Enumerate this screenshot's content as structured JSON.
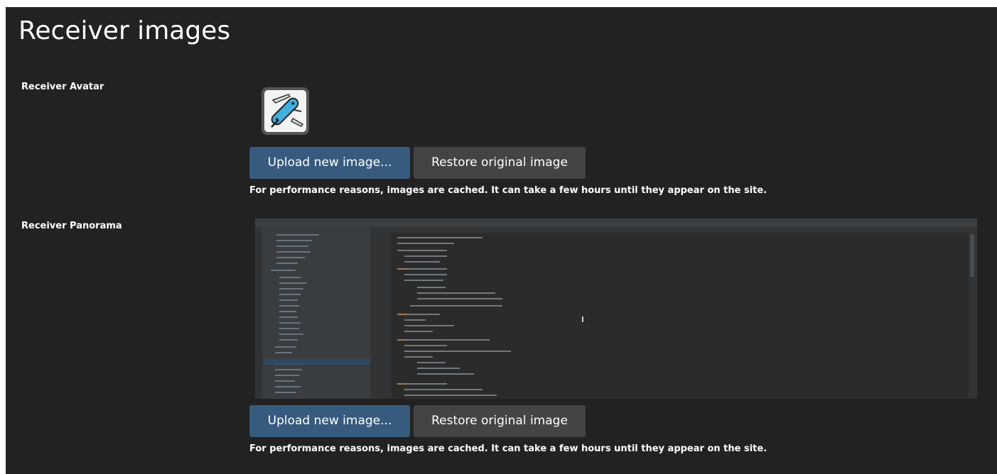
{
  "page": {
    "title": "Receiver images"
  },
  "avatar_section": {
    "label": "Receiver Avatar",
    "upload_label": "Upload new image...",
    "restore_label": "Restore original image",
    "help_text": "For performance reasons, images are cached. It can take a few hours until they appear on the site."
  },
  "panorama_section": {
    "label": "Receiver Panorama",
    "upload_label": "Upload new image...",
    "restore_label": "Restore original image",
    "help_text": "For performance reasons, images are cached. It can take a few hours until they appear on the site."
  },
  "colors": {
    "panel_background": "#222222",
    "primary_button": "#375a7f",
    "secondary_button": "#444444",
    "text": "#ffffff"
  },
  "icons": {
    "avatar": "swiss-army-knife-icon"
  }
}
